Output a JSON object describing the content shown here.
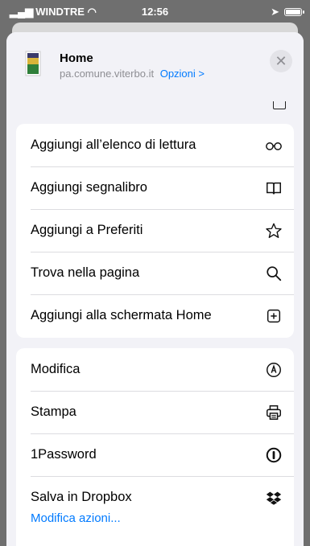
{
  "status_bar": {
    "carrier": "WINDTRE",
    "time": "12:56"
  },
  "sheet": {
    "title": "Home",
    "domain": "pa.comune.viterbo.it",
    "options_link": "Opzioni >",
    "close_glyph": "✕"
  },
  "group1": {
    "items": [
      {
        "label": "Aggiungi all’elenco di lettura",
        "icon": "reading-glasses-icon"
      },
      {
        "label": "Aggiungi segnalibro",
        "icon": "book-icon"
      },
      {
        "label": "Aggiungi a Preferiti",
        "icon": "star-icon"
      },
      {
        "label": "Trova nella pagina",
        "icon": "search-icon"
      },
      {
        "label": "Aggiungi alla schermata Home",
        "icon": "plus-square-icon"
      }
    ]
  },
  "group2": {
    "items": [
      {
        "label": "Modifica",
        "icon": "markup-icon"
      },
      {
        "label": "Stampa",
        "icon": "printer-icon"
      },
      {
        "label": "1Password",
        "icon": "1password-icon"
      },
      {
        "label": "Salva in Dropbox",
        "icon": "dropbox-icon"
      }
    ]
  },
  "footer": {
    "edit_actions": "Modifica azioni..."
  },
  "colors": {
    "accent": "#007aff",
    "sheet_bg": "#f2f2f7",
    "group_bg": "#ffffff"
  }
}
